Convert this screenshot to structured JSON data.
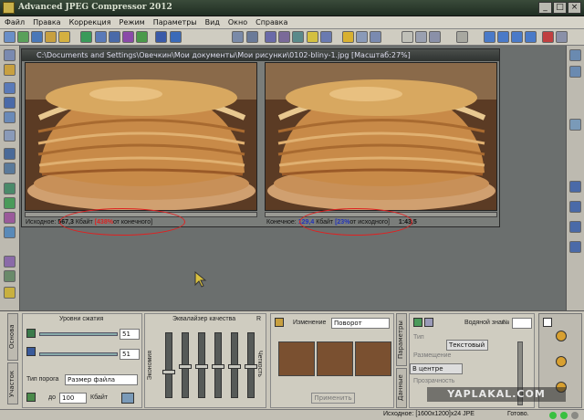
{
  "window": {
    "title": "Advanced JPEG Compressor 2012"
  },
  "menu": [
    "Файл",
    "Правка",
    "Коррекция",
    "Режим",
    "Параметры",
    "Вид",
    "Окно",
    "Справка"
  ],
  "image_window": {
    "title": "C:\\Documents and Settings\\Овечкин\\Мои документы\\Мои рисунки\\0102-bliny-1.jpg   [Масштаб:27%]",
    "source_label": "Исходное:",
    "source_size": "567,3",
    "source_unit": "Кбайт",
    "source_pct": "[438%",
    "source_suffix": "от конечного]",
    "final_label": "Конечное:",
    "final_size": "129,4",
    "final_unit": "Кбайт",
    "final_pct": "[23%",
    "final_suffix": "от исходного]",
    "ratio": "1:43,5"
  },
  "bottom": {
    "tab_main": "Основа",
    "tab_area": "Участок",
    "compression_levels": "Уровни сжатия",
    "level1": "51",
    "level2": "51",
    "threshold_type": "Тип порога",
    "threshold_value": "Размер файла",
    "upto": "до",
    "kb_value": "100",
    "kb_unit": "Кбайт",
    "equalizer": "Эквалайзер качества",
    "eq_r": "R",
    "eq_cheaper": "Экономия",
    "eq_sharp": "Четкость",
    "change_label": "Изменение",
    "change_value": "Поворот",
    "apply": "Применить",
    "params_tab": "Параметры",
    "data_tab": "Данные",
    "watermark_label": "Водяной знак",
    "wm_no": "№",
    "type_label": "Тип",
    "type_value": "Текстовый",
    "placement_label": "Размещение",
    "placement_value": "В центре",
    "transparency_label": "Прозрачность"
  },
  "status": {
    "source": "Исходное: [1600x1200]x24 JPE",
    "ready": "Готово."
  },
  "overlay_watermark": "YAPLAKAL.COM",
  "colors": {
    "red_oval": "#e02020",
    "blue_pct": "#2233bb",
    "red_pct": "#d22222"
  }
}
